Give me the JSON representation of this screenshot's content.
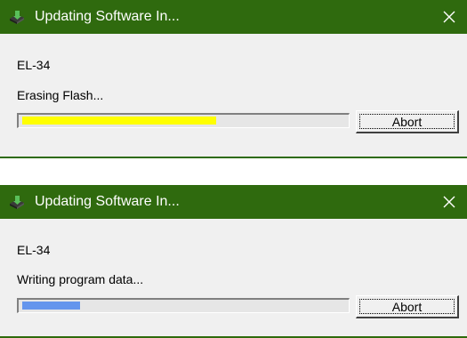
{
  "colors": {
    "titlebar": "#2f6a0e",
    "progress_erase": "#ffff00",
    "progress_write": "#6495ed"
  },
  "dialogs": [
    {
      "title": "Updating Software In...",
      "device": "EL-34",
      "status": "Erasing Flash...",
      "progress_fraction": 0.6,
      "abort_label": "Abort",
      "icon": "software-update-icon"
    },
    {
      "title": "Updating Software In...",
      "device": "EL-34",
      "status": "Writing program data...",
      "progress_fraction": 0.18,
      "abort_label": "Abort",
      "icon": "software-update-icon"
    }
  ]
}
